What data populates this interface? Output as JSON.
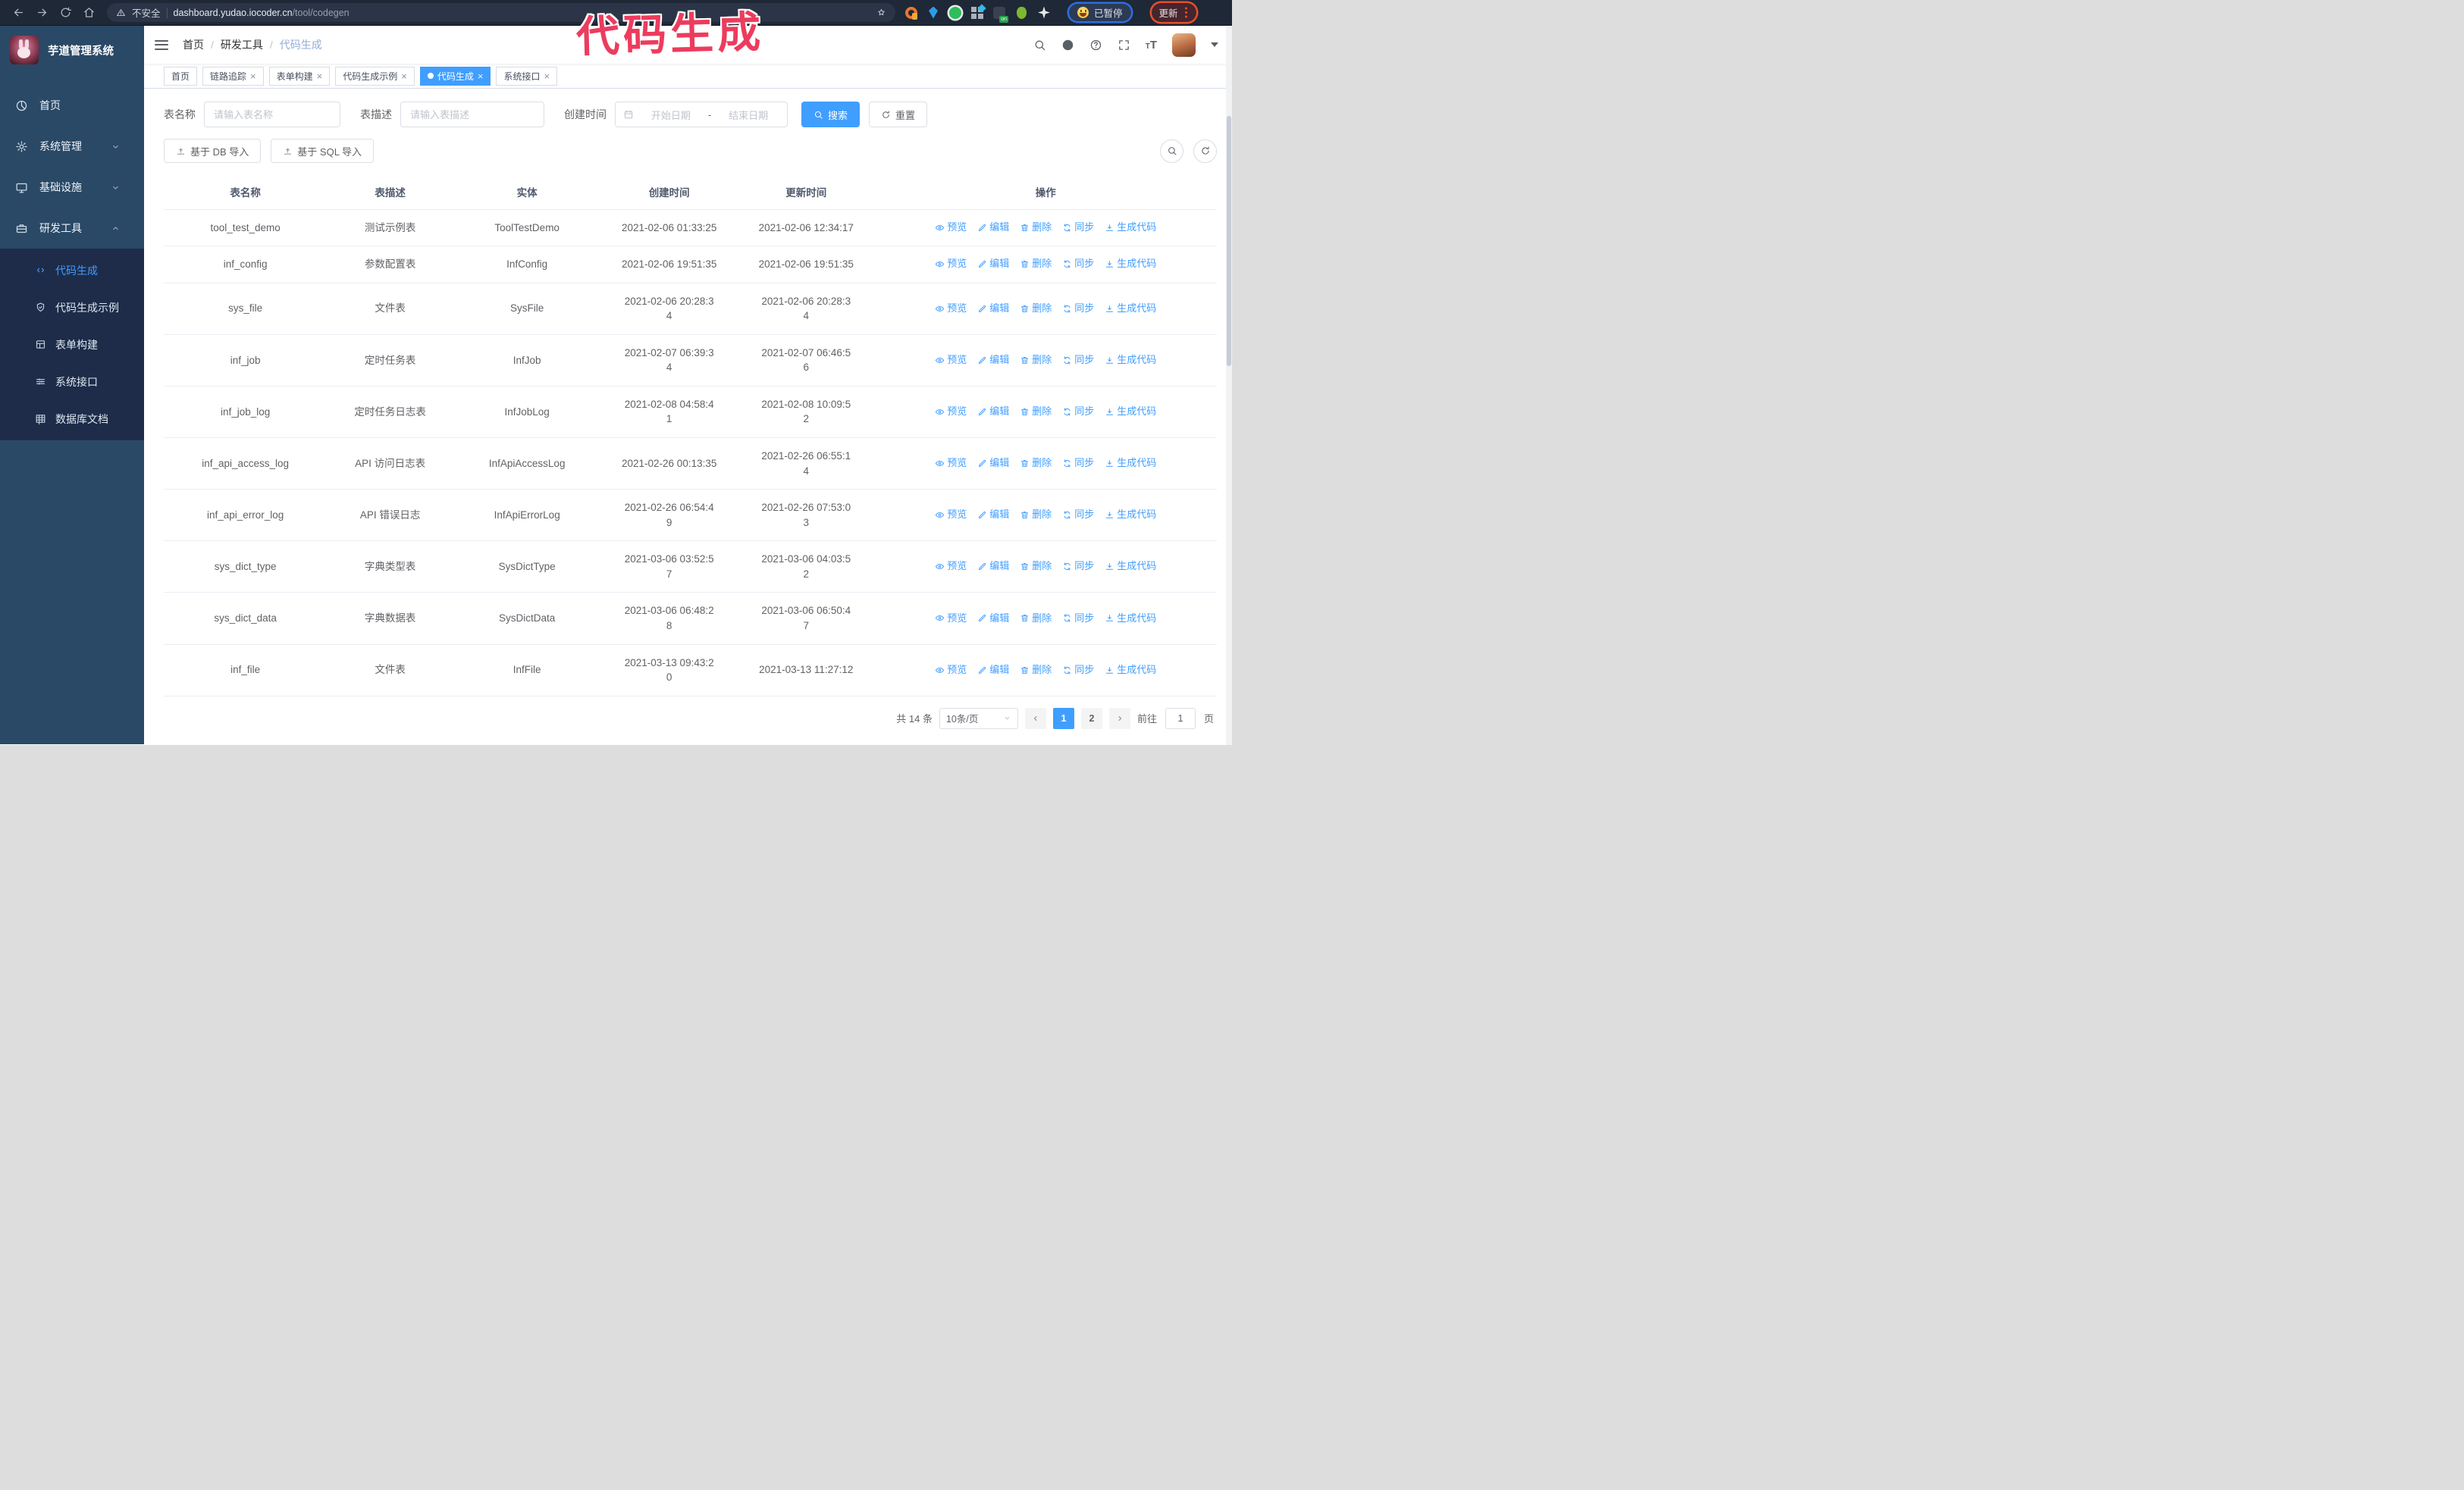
{
  "browser": {
    "security_label": "不安全",
    "url_host": "dashboard.yudao.iocoder.cn",
    "url_path": "/tool/codegen",
    "extensions": [
      "orange-ring",
      "blue-gem",
      "green-shield",
      "grid-diamond",
      "dark-on",
      "green-alien",
      "white-puzzle"
    ],
    "paused_label": "已暂停",
    "update_label": "更新"
  },
  "annotation": {
    "text": "代码生成",
    "color": "#ec3c5e"
  },
  "sidebar": {
    "logo_title": "芋道管理系统",
    "items": [
      {
        "id": "home",
        "label": "首页",
        "icon": "dashboard",
        "expandable": false
      },
      {
        "id": "system-management",
        "label": "系统管理",
        "icon": "gear",
        "expandable": true,
        "state": "collapsed"
      },
      {
        "id": "infrastructure",
        "label": "基础设施",
        "icon": "monitor",
        "expandable": true,
        "state": "collapsed"
      },
      {
        "id": "dev-tools",
        "label": "研发工具",
        "icon": "toolbox",
        "expandable": true,
        "state": "expanded"
      }
    ],
    "submenu": [
      {
        "id": "codegen",
        "label": "代码生成",
        "icon": "code",
        "active": true
      },
      {
        "id": "codegen-example",
        "label": "代码生成示例",
        "icon": "shield",
        "active": false
      },
      {
        "id": "form-builder",
        "label": "表单构建",
        "icon": "form",
        "active": false
      },
      {
        "id": "system-api",
        "label": "系统接口",
        "icon": "sliders",
        "active": false
      },
      {
        "id": "db-doc",
        "label": "数据库文档",
        "icon": "database",
        "active": false
      }
    ]
  },
  "navbar": {
    "breadcrumb": [
      "首页",
      "研发工具",
      "代码生成"
    ],
    "icons": [
      "search",
      "github",
      "help",
      "fullscreen",
      "font-size"
    ]
  },
  "tags": [
    {
      "label": "首页",
      "closable": false,
      "active": false
    },
    {
      "label": "链路追踪",
      "closable": true,
      "active": false
    },
    {
      "label": "表单构建",
      "closable": true,
      "active": false
    },
    {
      "label": "代码生成示例",
      "closable": true,
      "active": false
    },
    {
      "label": "代码生成",
      "closable": true,
      "active": true
    },
    {
      "label": "系统接口",
      "closable": true,
      "active": false
    }
  ],
  "filters": {
    "table_name_label": "表名称",
    "table_name_placeholder": "请输入表名称",
    "table_desc_label": "表描述",
    "table_desc_placeholder": "请输入表描述",
    "create_time_label": "创建时间",
    "date_start_placeholder": "开始日期",
    "date_separator": "-",
    "date_end_placeholder": "结束日期",
    "search_label": "搜索",
    "reset_label": "重置"
  },
  "toolbar": {
    "db_import_label": "基于 DB 导入",
    "sql_import_label": "基于 SQL 导入"
  },
  "table": {
    "columns": [
      "表名称",
      "表描述",
      "实体",
      "创建时间",
      "更新时间",
      "操作"
    ],
    "actions": [
      "预览",
      "编辑",
      "删除",
      "同步",
      "生成代码"
    ],
    "rows": [
      {
        "name": "tool_test_demo",
        "desc": "测试示例表",
        "entity": "ToolTestDemo",
        "created": "2021-02-06 01:33:25",
        "updated": "2021-02-06 12:34:17"
      },
      {
        "name": "inf_config",
        "desc": "参数配置表",
        "entity": "InfConfig",
        "created": "2021-02-06 19:51:35",
        "updated": "2021-02-06 19:51:35"
      },
      {
        "name": "sys_file",
        "desc": "文件表",
        "entity": "SysFile",
        "created": "2021-02-06 20:28:3\n4",
        "updated": "2021-02-06 20:28:3\n4"
      },
      {
        "name": "inf_job",
        "desc": "定时任务表",
        "entity": "InfJob",
        "created": "2021-02-07 06:39:3\n4",
        "updated": "2021-02-07 06:46:5\n6"
      },
      {
        "name": "inf_job_log",
        "desc": "定时任务日志表",
        "entity": "InfJobLog",
        "created": "2021-02-08 04:58:4\n1",
        "updated": "2021-02-08 10:09:5\n2"
      },
      {
        "name": "inf_api_access_log",
        "desc": "API 访问日志表",
        "entity": "InfApiAccessLog",
        "created": "2021-02-26 00:13:35",
        "updated": "2021-02-26 06:55:1\n4"
      },
      {
        "name": "inf_api_error_log",
        "desc": "API 错误日志",
        "entity": "InfApiErrorLog",
        "created": "2021-02-26 06:54:4\n9",
        "updated": "2021-02-26 07:53:0\n3"
      },
      {
        "name": "sys_dict_type",
        "desc": "字典类型表",
        "entity": "SysDictType",
        "created": "2021-03-06 03:52:5\n7",
        "updated": "2021-03-06 04:03:5\n2"
      },
      {
        "name": "sys_dict_data",
        "desc": "字典数据表",
        "entity": "SysDictData",
        "created": "2021-03-06 06:48:2\n8",
        "updated": "2021-03-06 06:50:4\n7"
      },
      {
        "name": "inf_file",
        "desc": "文件表",
        "entity": "InfFile",
        "created": "2021-03-13 09:43:2\n0",
        "updated": "2021-03-13 11:27:12"
      }
    ]
  },
  "pagination": {
    "total_label": "共 14 条",
    "page_size_label": "10条/页",
    "pages": [
      "1",
      "2"
    ],
    "active_page": "1",
    "goto_label": "前往",
    "goto_value": "1",
    "page_suffix": "页"
  },
  "colors": {
    "primary": "#409eff",
    "annotation_pink": "#ec3c5e",
    "sidebar_bg": "#2a4966",
    "submenu_bg": "#1e2c4a",
    "chrome_bg": "#1e2836"
  }
}
